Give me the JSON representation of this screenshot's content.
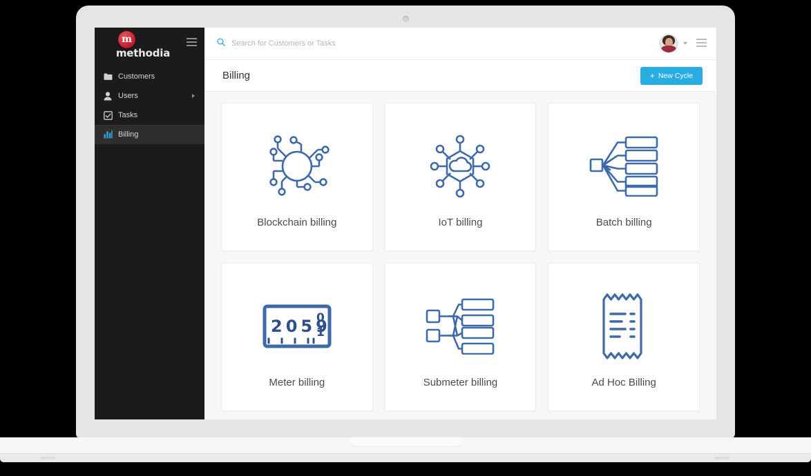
{
  "sidebar": {
    "brand": {
      "mark": "m",
      "name": "methodia"
    },
    "toggle_icon": "hamburger-icon",
    "items": [
      {
        "label": "Customers",
        "icon": "folder-icon",
        "active": false,
        "has_caret": false
      },
      {
        "label": "Users",
        "icon": "user-icon",
        "active": false,
        "has_caret": true
      },
      {
        "label": "Tasks",
        "icon": "checkbox-icon",
        "active": false,
        "has_caret": false
      },
      {
        "label": "Billing",
        "icon": "bar-chart-icon",
        "active": true,
        "has_caret": false
      }
    ]
  },
  "topbar": {
    "search_placeholder": "Search for Customers or Tasks",
    "search_value": "",
    "search_icon": "search-icon",
    "avatar": "user-avatar",
    "avatar_caret": "chevron-down-icon",
    "menu_icon": "hamburger-icon"
  },
  "pagebar": {
    "title": "Billing",
    "new_cycle_label": "New Cycle",
    "new_cycle_plus": "+",
    "accent_color": "#28ade3"
  },
  "cards": [
    {
      "label": "Blockchain billing",
      "icon": "blockchain-network-icon"
    },
    {
      "label": "IoT billing",
      "icon": "iot-cloud-network-icon"
    },
    {
      "label": "Batch billing",
      "icon": "batch-converge-icon"
    },
    {
      "label": "Meter billing",
      "icon": "meter-dial-icon",
      "meter_digits": "2059",
      "meter_roll_top": "0",
      "meter_roll_bottom": "1"
    },
    {
      "label": "Submeter billing",
      "icon": "submeter-tree-icon"
    },
    {
      "label": "Ad Hoc Billing",
      "icon": "receipt-icon"
    }
  ],
  "theme": {
    "icon_blue": "#3e69ab",
    "sidebar_bg": "#1b1b1b",
    "content_bg": "#f7f7f8"
  }
}
